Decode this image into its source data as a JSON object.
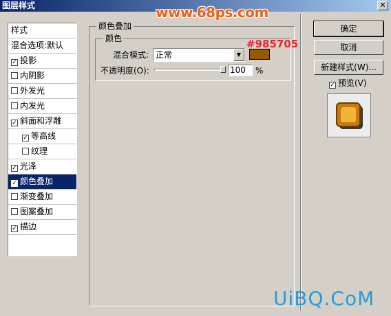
{
  "window": {
    "title": "图层样式",
    "close_glyph": "✕",
    "watermark": "www.68ps.com"
  },
  "style_list": {
    "items": [
      {
        "label": "样式",
        "checkbox": false,
        "checked": false,
        "selected": false,
        "indent": false
      },
      {
        "label": "混合选项:默认",
        "checkbox": false,
        "checked": false,
        "selected": false,
        "indent": false
      },
      {
        "label": "投影",
        "checkbox": true,
        "checked": true,
        "selected": false,
        "indent": false
      },
      {
        "label": "内阴影",
        "checkbox": true,
        "checked": false,
        "selected": false,
        "indent": false
      },
      {
        "label": "外发光",
        "checkbox": true,
        "checked": false,
        "selected": false,
        "indent": false
      },
      {
        "label": "内发光",
        "checkbox": true,
        "checked": false,
        "selected": false,
        "indent": false
      },
      {
        "label": "斜面和浮雕",
        "checkbox": true,
        "checked": true,
        "selected": false,
        "indent": false
      },
      {
        "label": "等高线",
        "checkbox": true,
        "checked": true,
        "selected": false,
        "indent": true
      },
      {
        "label": "纹理",
        "checkbox": true,
        "checked": false,
        "selected": false,
        "indent": true
      },
      {
        "label": "光泽",
        "checkbox": true,
        "checked": true,
        "selected": false,
        "indent": false
      },
      {
        "label": "颜色叠加",
        "checkbox": true,
        "checked": true,
        "selected": true,
        "indent": false
      },
      {
        "label": "渐变叠加",
        "checkbox": true,
        "checked": false,
        "selected": false,
        "indent": false
      },
      {
        "label": "图案叠加",
        "checkbox": true,
        "checked": false,
        "selected": false,
        "indent": false
      },
      {
        "label": "描边",
        "checkbox": true,
        "checked": true,
        "selected": false,
        "indent": false
      }
    ]
  },
  "panel": {
    "outer_title": "颜色叠加",
    "inner_title": "颜色",
    "blend_mode_label": "混合模式:",
    "blend_mode_value": "正常",
    "color_swatch": "#985705",
    "color_note": "#985705",
    "opacity_label": "不透明度(O):",
    "opacity_value": "100",
    "opacity_unit": "%",
    "opacity_fraction": 1.0
  },
  "buttons": {
    "ok": "确定",
    "cancel": "取消",
    "new_style": "新建样式(W)...",
    "preview_label": "预览(V)",
    "preview_checked": true
  },
  "footer": {
    "brand": "UiBQ.CoM"
  },
  "colors": {
    "selection": "#0a246a",
    "swatch": "#985705",
    "note_red": "#e8262c"
  }
}
